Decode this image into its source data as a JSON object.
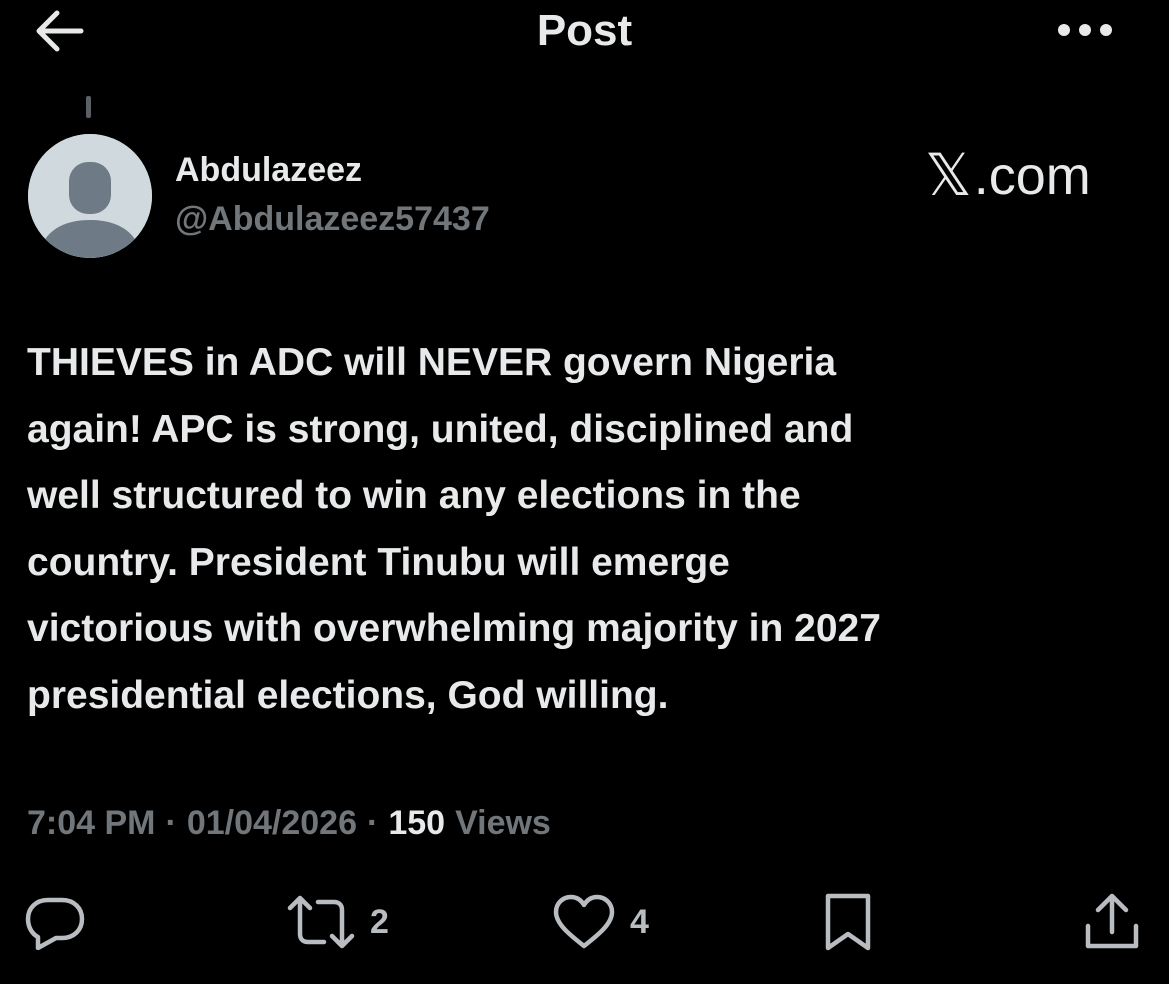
{
  "header": {
    "title": "Post",
    "back_icon": "arrow-left-icon",
    "more_icon": "more-horizontal-icon"
  },
  "author": {
    "name": "Abdulazeez",
    "handle": "@Abdulazeez57437",
    "avatar_icon": "default-avatar-icon"
  },
  "watermark": {
    "logo": "𝕏",
    "suffix": ".com"
  },
  "post": {
    "lines": [
      "THIEVES in ADC will NEVER govern Nigeria",
      "again! APC is strong, united, disciplined and",
      "well structured to win any elections in the",
      "country. President Tinubu will emerge",
      "victorious with overwhelming majority in 2027",
      "presidential elections, God willing."
    ]
  },
  "meta": {
    "time": "7:04 PM",
    "separator": "·",
    "date": "01/04/2026",
    "views_count": "150",
    "views_label": "Views"
  },
  "actions": {
    "reply": {
      "icon": "reply-icon",
      "count": ""
    },
    "repost": {
      "icon": "repost-icon",
      "count": "2"
    },
    "like": {
      "icon": "heart-icon",
      "count": "4"
    },
    "bookmark": {
      "icon": "bookmark-icon",
      "count": ""
    },
    "share": {
      "icon": "share-icon",
      "count": ""
    }
  },
  "colors": {
    "background": "#000000",
    "primary_text": "#e7e9ea",
    "secondary_text": "#71767b",
    "avatar_bg": "#cfd9de",
    "avatar_figure": "#6e7b86"
  }
}
